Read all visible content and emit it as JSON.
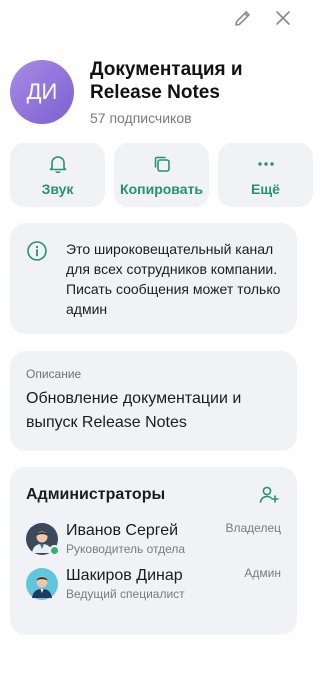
{
  "colors": {
    "accent": "#26936a",
    "card_bg": "#f1f2f5",
    "avatar_gradient": [
      "#a98be6",
      "#7d5fd1"
    ],
    "online": "#2fb36c"
  },
  "topbar": {
    "edit_icon": "pencil-icon",
    "close_icon": "close-icon"
  },
  "channel": {
    "avatar_initials": "ДИ",
    "title": "Документация и Release Notes",
    "subscribers": "57 подписчиков"
  },
  "actions": [
    {
      "label": "Звук",
      "icon": "bell-icon"
    },
    {
      "label": "Копировать",
      "icon": "copy-icon"
    },
    {
      "label": "Ещё",
      "icon": "more-dots-icon"
    }
  ],
  "info": {
    "icon": "info-icon",
    "text": "Это широковещательный канал для всех сотрудников компании. Писать сообщения может только админ"
  },
  "description": {
    "label": "Описание",
    "text": "Обновление документации и выпуск Release Notes"
  },
  "admins": {
    "title": "Администраторы",
    "add_icon": "add-user-icon",
    "list": [
      {
        "name": "Иванов Сергей",
        "position": "Руководитель отдела",
        "role": "Владелец",
        "online": true
      },
      {
        "name": "Шакиров Динар",
        "position": "Ведущий специалист",
        "role": "Админ",
        "online": false
      }
    ]
  }
}
